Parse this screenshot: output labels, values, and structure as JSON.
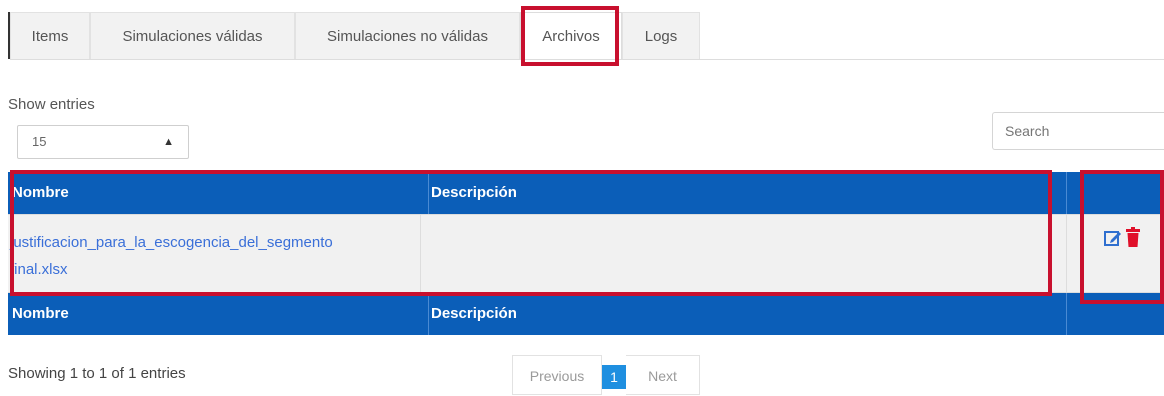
{
  "tabs": [
    {
      "label": "Items"
    },
    {
      "label": "Simulaciones válidas"
    },
    {
      "label": "Simulaciones no válidas"
    },
    {
      "label": "Archivos"
    },
    {
      "label": "Logs"
    }
  ],
  "length": {
    "label": "Show entries",
    "value": "15"
  },
  "search": {
    "placeholder": "Search"
  },
  "table": {
    "headers": {
      "nombre": "Nombre",
      "descripcion": "Descripción"
    },
    "rows": [
      {
        "nombre_line1": "justificacion_para_la_escogencia_del_segmento",
        "nombre_line2": "final.xlsx",
        "descripcion": ""
      }
    ]
  },
  "info": "Showing 1 to 1 of 1 entries",
  "pagination": {
    "previous": "Previous",
    "current": "1",
    "next": "Next"
  },
  "colors": {
    "header_bg": "#0b5eb8",
    "annotation": "#c8102e",
    "link": "#3a6fd8",
    "page_active": "#1f8fe0"
  }
}
